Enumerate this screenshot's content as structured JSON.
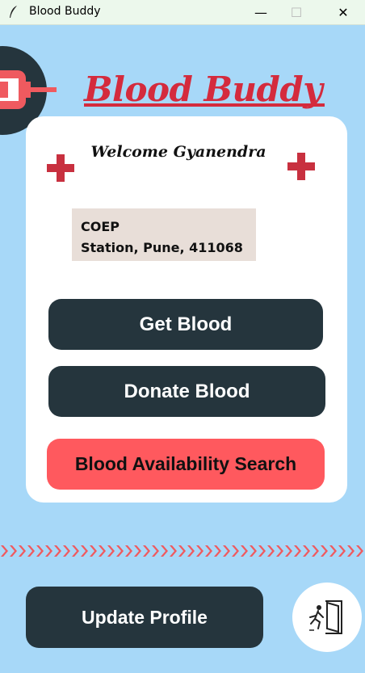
{
  "window": {
    "title": "Blood Buddy",
    "minimize_glyph": "—",
    "maximize_glyph": "☐",
    "close_glyph": "✕"
  },
  "brand": {
    "title": "Blood Buddy",
    "logo_icon": "syringe-icon",
    "accent_color": "#d42b3d"
  },
  "home": {
    "welcome": "Welcome Gyanendra",
    "address_line1": "COEP",
    "address_line2": "Station, Pune, 411068",
    "get_blood_label": "Get Blood",
    "donate_blood_label": "Donate Blood",
    "availability_search_label": "Blood Availability Search",
    "update_profile_label": "Update Profile",
    "logout_icon": "exit-door-icon"
  },
  "colors": {
    "background": "#a7d8f8",
    "card": "#ffffff",
    "dark_button": "#25353d",
    "search_button": "#ff595e",
    "cross": "#c8303f"
  }
}
